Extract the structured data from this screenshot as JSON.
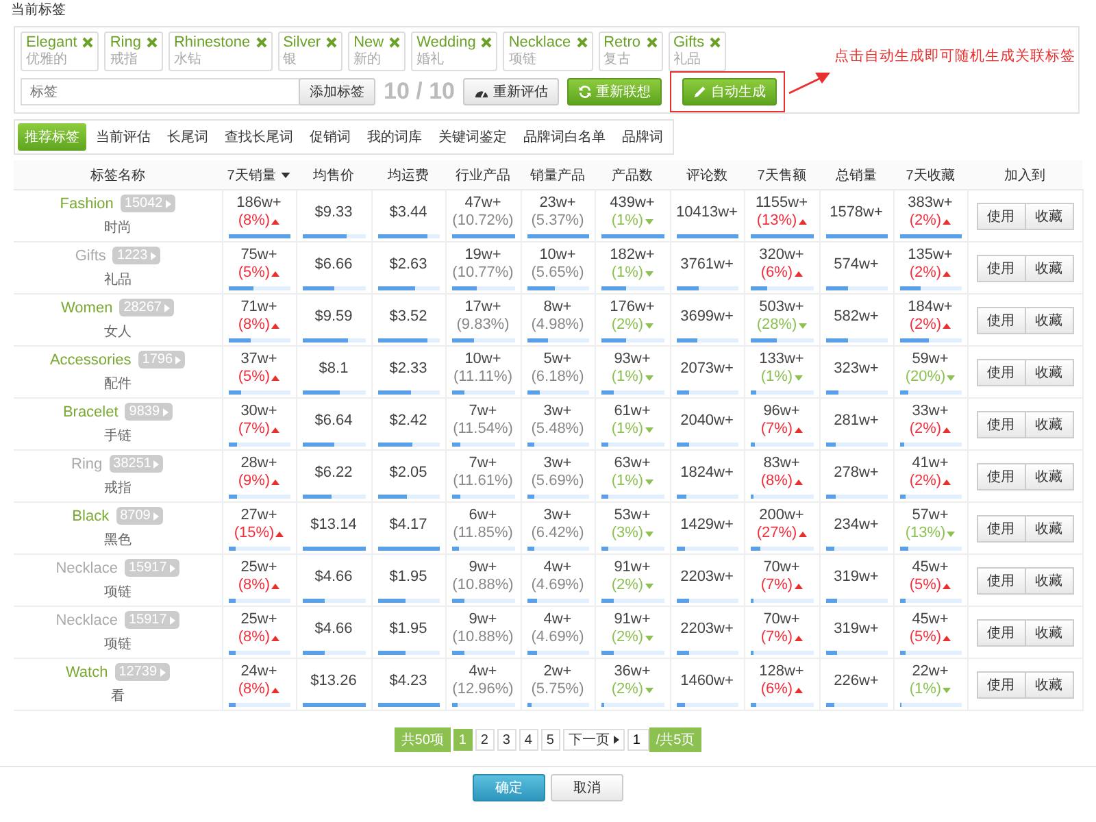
{
  "heading": "当前标签",
  "tags": [
    {
      "label": "Elegant",
      "sub": "优雅的"
    },
    {
      "label": "Ring",
      "sub": "戒指"
    },
    {
      "label": "Rhinestone",
      "sub": "水钻"
    },
    {
      "label": "Silver",
      "sub": "银"
    },
    {
      "label": "New",
      "sub": "新的"
    },
    {
      "label": "Wedding",
      "sub": "婚礼"
    },
    {
      "label": "Necklace",
      "sub": "项链"
    },
    {
      "label": "Retro",
      "sub": "复古"
    },
    {
      "label": "Gifts",
      "sub": "礼品"
    }
  ],
  "tag_input": {
    "placeholder": "标签",
    "add_button": "添加标签",
    "count": "10 / 10"
  },
  "actions": [
    {
      "label": "重新评估",
      "kind": "gauge"
    },
    {
      "label": "重新联想",
      "kind": "refresh"
    },
    {
      "label": "自动生成",
      "kind": "pencil"
    }
  ],
  "annotation": {
    "text": "点击自动生成即可随机生成关联标签"
  },
  "tabs": [
    {
      "label": "推荐标签",
      "selected": true
    },
    {
      "label": "当前评估",
      "selected": false
    },
    {
      "label": "长尾词",
      "selected": false
    },
    {
      "label": "查找长尾词",
      "selected": false
    },
    {
      "label": "促销词",
      "selected": false
    },
    {
      "label": "我的词库",
      "selected": false
    },
    {
      "label": "关键词鉴定",
      "selected": false
    },
    {
      "label": "品牌词白名单",
      "selected": false
    },
    {
      "label": "品牌词",
      "selected": false
    }
  ],
  "columns": [
    {
      "label": "标签名称",
      "sorted": false
    },
    {
      "label": "7天销量",
      "sorted": true
    },
    {
      "label": "均售价",
      "sorted": false
    },
    {
      "label": "均运费",
      "sorted": false
    },
    {
      "label": "行业产品",
      "sorted": false
    },
    {
      "label": "销量产品",
      "sorted": false
    },
    {
      "label": "产品数",
      "sorted": false
    },
    {
      "label": "评论数",
      "sorted": false
    },
    {
      "label": "7天售额",
      "sorted": false
    },
    {
      "label": "总销量",
      "sorted": false
    },
    {
      "label": "7天收藏",
      "sorted": false
    },
    {
      "label": "加入到",
      "sorted": false
    }
  ],
  "rows": [
    {
      "name": "Fashion",
      "count": "15042",
      "cn": "时尚",
      "highlighted": true,
      "buttons": [
        "使用",
        "收藏"
      ],
      "cells": [
        {
          "kind": "trend",
          "value": "186w+",
          "note": "(8%)",
          "rising": true,
          "level": 1
        },
        {
          "kind": "plain",
          "value": "$9.33",
          "level": 0.7
        },
        {
          "kind": "plain",
          "value": "$3.44",
          "level": 0.8
        },
        {
          "kind": "share",
          "value": "47w+",
          "note": "(10.72%)",
          "level": 1
        },
        {
          "kind": "share",
          "value": "23w+",
          "note": "(5.37%)",
          "level": 1
        },
        {
          "kind": "trend",
          "value": "439w+",
          "note": "(1%)",
          "rising": false,
          "level": 1
        },
        {
          "kind": "plain",
          "value": "10413w+",
          "level": 1
        },
        {
          "kind": "trend",
          "value": "1155w+",
          "note": "(13%)",
          "rising": true,
          "level": 1
        },
        {
          "kind": "plain",
          "value": "1578w+",
          "level": 1
        },
        {
          "kind": "trend",
          "value": "383w+",
          "note": "(2%)",
          "rising": true,
          "level": 1
        }
      ]
    },
    {
      "name": "Gifts",
      "count": "1223",
      "cn": "礼品",
      "highlighted": false,
      "buttons": [
        "使用",
        "收藏"
      ],
      "cells": [
        {
          "kind": "trend",
          "value": "75w+",
          "note": "(5%)",
          "rising": true,
          "level": 0.4
        },
        {
          "kind": "plain",
          "value": "$6.66",
          "level": 0.5
        },
        {
          "kind": "plain",
          "value": "$2.63",
          "level": 0.6
        },
        {
          "kind": "share",
          "value": "19w+",
          "note": "(10.77%)",
          "level": 0.4
        },
        {
          "kind": "share",
          "value": "10w+",
          "note": "(5.65%)",
          "level": 0.45
        },
        {
          "kind": "trend",
          "value": "182w+",
          "note": "(1%)",
          "rising": false,
          "level": 0.4
        },
        {
          "kind": "plain",
          "value": "3761w+",
          "level": 0.36
        },
        {
          "kind": "trend",
          "value": "320w+",
          "note": "(6%)",
          "rising": true,
          "level": 0.28
        },
        {
          "kind": "plain",
          "value": "574w+",
          "level": 0.36
        },
        {
          "kind": "trend",
          "value": "135w+",
          "note": "(2%)",
          "rising": true,
          "level": 0.35
        }
      ]
    },
    {
      "name": "Women",
      "count": "28267",
      "cn": "女人",
      "highlighted": true,
      "buttons": [
        "使用",
        "收藏"
      ],
      "cells": [
        {
          "kind": "trend",
          "value": "71w+",
          "note": "(8%)",
          "rising": true,
          "level": 0.37
        },
        {
          "kind": "plain",
          "value": "$9.59",
          "level": 0.72
        },
        {
          "kind": "plain",
          "value": "$3.52",
          "level": 0.82
        },
        {
          "kind": "share",
          "value": "17w+",
          "note": "(9.83%)",
          "level": 0.36
        },
        {
          "kind": "share",
          "value": "8w+",
          "note": "(4.98%)",
          "level": 0.35
        },
        {
          "kind": "trend",
          "value": "176w+",
          "note": "(2%)",
          "rising": false,
          "level": 0.4
        },
        {
          "kind": "plain",
          "value": "3699w+",
          "level": 0.35
        },
        {
          "kind": "trend",
          "value": "503w+",
          "note": "(28%)",
          "rising": false,
          "level": 0.43
        },
        {
          "kind": "plain",
          "value": "582w+",
          "level": 0.36
        },
        {
          "kind": "trend",
          "value": "184w+",
          "note": "(2%)",
          "rising": true,
          "level": 0.48
        }
      ]
    },
    {
      "name": "Accessories",
      "count": "1796",
      "cn": "配件",
      "highlighted": true,
      "buttons": [
        "使用",
        "收藏"
      ],
      "cells": [
        {
          "kind": "trend",
          "value": "37w+",
          "note": "(5%)",
          "rising": true,
          "level": 0.2
        },
        {
          "kind": "plain",
          "value": "$8.1",
          "level": 0.6
        },
        {
          "kind": "plain",
          "value": "$2.33",
          "level": 0.55
        },
        {
          "kind": "share",
          "value": "10w+",
          "note": "(11.11%)",
          "level": 0.21
        },
        {
          "kind": "share",
          "value": "5w+",
          "note": "(6.18%)",
          "level": 0.22
        },
        {
          "kind": "trend",
          "value": "93w+",
          "note": "(1%)",
          "rising": false,
          "level": 0.21
        },
        {
          "kind": "plain",
          "value": "2073w+",
          "level": 0.2
        },
        {
          "kind": "trend",
          "value": "133w+",
          "note": "(1%)",
          "rising": false,
          "level": 0.1
        },
        {
          "kind": "plain",
          "value": "323w+",
          "level": 0.2
        },
        {
          "kind": "trend",
          "value": "59w+",
          "note": "(20%)",
          "rising": false,
          "level": 0.15
        }
      ]
    },
    {
      "name": "Bracelet",
      "count": "9839",
      "cn": "手链",
      "highlighted": true,
      "buttons": [
        "使用",
        "收藏"
      ],
      "cells": [
        {
          "kind": "trend",
          "value": "30w+",
          "note": "(7%)",
          "rising": true,
          "level": 0.15
        },
        {
          "kind": "plain",
          "value": "$6.64",
          "level": 0.5
        },
        {
          "kind": "plain",
          "value": "$2.42",
          "level": 0.57
        },
        {
          "kind": "share",
          "value": "7w+",
          "note": "(11.54%)",
          "level": 0.15
        },
        {
          "kind": "share",
          "value": "3w+",
          "note": "(5.48%)",
          "level": 0.13
        },
        {
          "kind": "trend",
          "value": "61w+",
          "note": "(1%)",
          "rising": false,
          "level": 0.13
        },
        {
          "kind": "plain",
          "value": "2040w+",
          "level": 0.2
        },
        {
          "kind": "trend",
          "value": "96w+",
          "note": "(7%)",
          "rising": true,
          "level": 0.07
        },
        {
          "kind": "plain",
          "value": "281w+",
          "level": 0.17
        },
        {
          "kind": "trend",
          "value": "33w+",
          "note": "(2%)",
          "rising": true,
          "level": 0.08
        }
      ]
    },
    {
      "name": "Ring",
      "count": "38251",
      "cn": "戒指",
      "highlighted": false,
      "buttons": [
        "使用",
        "收藏"
      ],
      "cells": [
        {
          "kind": "trend",
          "value": "28w+",
          "note": "(9%)",
          "rising": true,
          "level": 0.14
        },
        {
          "kind": "plain",
          "value": "$6.22",
          "level": 0.47
        },
        {
          "kind": "plain",
          "value": "$2.05",
          "level": 0.48
        },
        {
          "kind": "share",
          "value": "7w+",
          "note": "(11.61%)",
          "level": 0.15
        },
        {
          "kind": "share",
          "value": "3w+",
          "note": "(5.69%)",
          "level": 0.13
        },
        {
          "kind": "trend",
          "value": "63w+",
          "note": "(1%)",
          "rising": false,
          "level": 0.13
        },
        {
          "kind": "plain",
          "value": "1824w+",
          "level": 0.17
        },
        {
          "kind": "trend",
          "value": "83w+",
          "note": "(8%)",
          "rising": true,
          "level": 0.06
        },
        {
          "kind": "plain",
          "value": "278w+",
          "level": 0.17
        },
        {
          "kind": "trend",
          "value": "41w+",
          "note": "(2%)",
          "rising": true,
          "level": 0.1
        }
      ]
    },
    {
      "name": "Black",
      "count": "8709",
      "cn": "黑色",
      "highlighted": true,
      "buttons": [
        "使用",
        "收藏"
      ],
      "cells": [
        {
          "kind": "trend",
          "value": "27w+",
          "note": "(15%)",
          "rising": true,
          "level": 0.13
        },
        {
          "kind": "plain",
          "value": "$13.14",
          "level": 1
        },
        {
          "kind": "plain",
          "value": "$4.17",
          "level": 1
        },
        {
          "kind": "share",
          "value": "6w+",
          "note": "(11.85%)",
          "level": 0.13
        },
        {
          "kind": "share",
          "value": "3w+",
          "note": "(6.42%)",
          "level": 0.13
        },
        {
          "kind": "trend",
          "value": "53w+",
          "note": "(3%)",
          "rising": false,
          "level": 0.12
        },
        {
          "kind": "plain",
          "value": "1429w+",
          "level": 0.14
        },
        {
          "kind": "trend",
          "value": "200w+",
          "note": "(27%)",
          "rising": true,
          "level": 0.16
        },
        {
          "kind": "plain",
          "value": "234w+",
          "level": 0.14
        },
        {
          "kind": "trend",
          "value": "57w+",
          "note": "(13%)",
          "rising": false,
          "level": 0.15
        }
      ]
    },
    {
      "name": "Necklace",
      "count": "15917",
      "cn": "项链",
      "highlighted": false,
      "buttons": [
        "使用",
        "收藏"
      ],
      "cells": [
        {
          "kind": "trend",
          "value": "25w+",
          "note": "(8%)",
          "rising": true,
          "level": 0.13
        },
        {
          "kind": "plain",
          "value": "$4.66",
          "level": 0.35
        },
        {
          "kind": "plain",
          "value": "$1.95",
          "level": 0.45
        },
        {
          "kind": "share",
          "value": "9w+",
          "note": "(10.88%)",
          "level": 0.2
        },
        {
          "kind": "share",
          "value": "4w+",
          "note": "(4.69%)",
          "level": 0.17
        },
        {
          "kind": "trend",
          "value": "91w+",
          "note": "(2%)",
          "rising": false,
          "level": 0.2
        },
        {
          "kind": "plain",
          "value": "2203w+",
          "level": 0.21
        },
        {
          "kind": "trend",
          "value": "70w+",
          "note": "(7%)",
          "rising": true,
          "level": 0.06
        },
        {
          "kind": "plain",
          "value": "319w+",
          "level": 0.19
        },
        {
          "kind": "trend",
          "value": "45w+",
          "note": "(5%)",
          "rising": true,
          "level": 0.1
        }
      ]
    },
    {
      "name": "Necklace",
      "count": "15917",
      "cn": "项链",
      "highlighted": false,
      "buttons": [
        "使用",
        "收藏"
      ],
      "cells": [
        {
          "kind": "trend",
          "value": "25w+",
          "note": "(8%)",
          "rising": true,
          "level": 0.13
        },
        {
          "kind": "plain",
          "value": "$4.66",
          "level": 0.35
        },
        {
          "kind": "plain",
          "value": "$1.95",
          "level": 0.45
        },
        {
          "kind": "share",
          "value": "9w+",
          "note": "(10.88%)",
          "level": 0.2
        },
        {
          "kind": "share",
          "value": "4w+",
          "note": "(4.69%)",
          "level": 0.17
        },
        {
          "kind": "trend",
          "value": "91w+",
          "note": "(2%)",
          "rising": false,
          "level": 0.2
        },
        {
          "kind": "plain",
          "value": "2203w+",
          "level": 0.21
        },
        {
          "kind": "trend",
          "value": "70w+",
          "note": "(7%)",
          "rising": true,
          "level": 0.06
        },
        {
          "kind": "plain",
          "value": "319w+",
          "level": 0.19
        },
        {
          "kind": "trend",
          "value": "45w+",
          "note": "(5%)",
          "rising": true,
          "level": 0.1
        }
      ]
    },
    {
      "name": "Watch",
      "count": "12739",
      "cn": "看",
      "highlighted": true,
      "buttons": [
        "使用",
        "收藏"
      ],
      "cells": [
        {
          "kind": "trend",
          "value": "24w+",
          "note": "(8%)",
          "rising": true,
          "level": 0.12
        },
        {
          "kind": "plain",
          "value": "$13.26",
          "level": 1
        },
        {
          "kind": "plain",
          "value": "$4.23",
          "level": 1
        },
        {
          "kind": "share",
          "value": "4w+",
          "note": "(12.96%)",
          "level": 0.09
        },
        {
          "kind": "share",
          "value": "2w+",
          "note": "(5.75%)",
          "level": 0.08
        },
        {
          "kind": "trend",
          "value": "36w+",
          "note": "(2%)",
          "rising": false,
          "level": 0.06
        },
        {
          "kind": "plain",
          "value": "1460w+",
          "level": 0.14
        },
        {
          "kind": "trend",
          "value": "128w+",
          "note": "(6%)",
          "rising": true,
          "level": 0.1
        },
        {
          "kind": "plain",
          "value": "226w+",
          "level": 0.14
        },
        {
          "kind": "trend",
          "value": "22w+",
          "note": "(1%)",
          "rising": false,
          "level": 0.02
        }
      ]
    }
  ],
  "pagination": {
    "total": "共50项",
    "pages": [
      {
        "label": "1",
        "selected": true
      },
      {
        "label": "2",
        "selected": false
      },
      {
        "label": "3",
        "selected": false
      },
      {
        "label": "4",
        "selected": false
      },
      {
        "label": "5",
        "selected": false
      }
    ],
    "next": "下一页",
    "page_value": "1",
    "page_total": "/共5页"
  },
  "footer": {
    "confirm": "确定",
    "cancel": "取消"
  }
}
